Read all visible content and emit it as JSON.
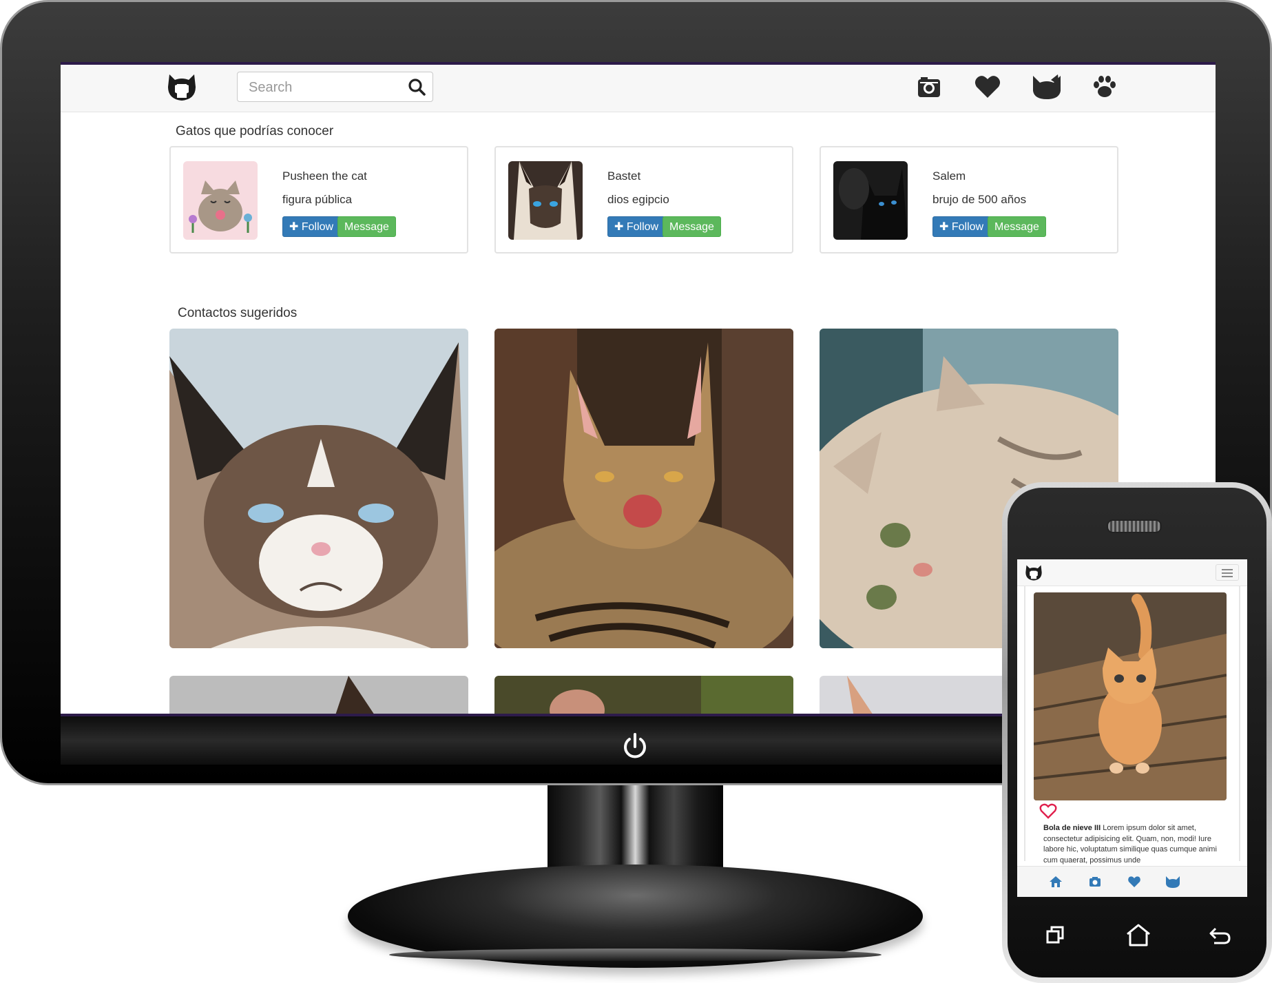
{
  "screen": {
    "search": {
      "placeholder": "Search"
    },
    "nav_icons": [
      "camera-icon",
      "heart-icon",
      "cat-head-icon",
      "paw-icon"
    ],
    "suggested_cats": {
      "title": "Gatos que podrías conocer",
      "cards": [
        {
          "name": "Pusheen the cat",
          "description": "figura pública",
          "follow_label": "Follow",
          "message_label": "Message"
        },
        {
          "name": "Bastet",
          "description": "dios egipcio",
          "follow_label": "Follow",
          "message_label": "Message"
        },
        {
          "name": "Salem",
          "description": "brujo de 500 años",
          "follow_label": "Follow",
          "message_label": "Message"
        }
      ]
    },
    "suggested_contacts": {
      "title": "Contactos sugeridos"
    }
  },
  "phone": {
    "caption_name": "Bola de nieve III",
    "caption_text": "Lorem ipsum dolor sit amet, consectetur adipisicing elit. Quam, non, modi! Iure labore hic, voluptatum similique quas cumque animi cum quaerat, possimus unde",
    "tab_icons": [
      "home-icon",
      "camera-icon",
      "heart-icon",
      "cat-head-icon"
    ]
  },
  "colors": {
    "follow": "#337ab7",
    "message": "#5cb85c",
    "tab_icon": "#337ab7",
    "heart_outline": "#e0204d",
    "screen_accent": "#2d1b4a"
  }
}
